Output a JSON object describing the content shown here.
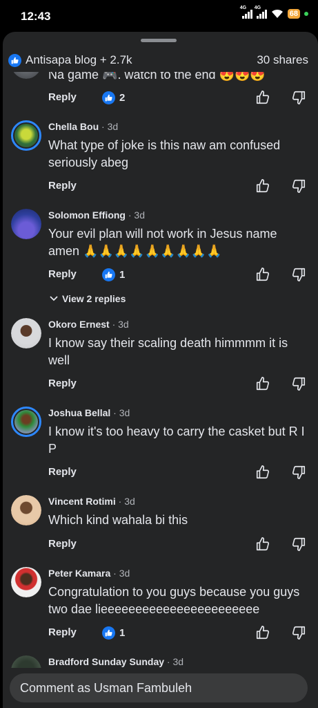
{
  "status": {
    "time": "12:43",
    "network1": "4G",
    "network2": "4G",
    "battery": "68"
  },
  "header": {
    "reactions": "Antisapa blog + 2.7k",
    "shares": "30 shares"
  },
  "comments": [
    {
      "name": "",
      "time": "",
      "text": "Na game 🎮. watch to the end 😍😍😍",
      "reply": "Reply",
      "likes": "2",
      "replies": ""
    },
    {
      "name": "Chella Bou",
      "time": "· 3d",
      "text": "What type of joke is this naw am confused seriously abeg",
      "reply": "Reply",
      "likes": "",
      "replies": ""
    },
    {
      "name": "Solomon Effiong",
      "time": "· 3d",
      "text": "Your evil plan will not work in Jesus name amen 🙏🙏🙏🙏🙏🙏🙏🙏🙏",
      "reply": "Reply",
      "likes": "1",
      "replies": "View 2 replies"
    },
    {
      "name": "Okoro Ernest",
      "time": "· 3d",
      "text": "I know say their scaling death himmmm it is well",
      "reply": "Reply",
      "likes": "",
      "replies": ""
    },
    {
      "name": "Joshua Bellal",
      "time": "· 3d",
      "text": "I know it's too heavy to carry the casket but R I P",
      "reply": "Reply",
      "likes": "",
      "replies": ""
    },
    {
      "name": "Vincent Rotimi",
      "time": "· 3d",
      "text": "Which kind wahala bi this",
      "reply": "Reply",
      "likes": "",
      "replies": ""
    },
    {
      "name": "Peter Kamara",
      "time": "· 3d",
      "text": "Congratulation to you guys because you guys two dae lieeeeeeeeeeeeeeeeeeeeeee",
      "reply": "Reply",
      "likes": "1",
      "replies": ""
    },
    {
      "name": "Bradford Sunday Sunday",
      "time": "· 3d",
      "text": "",
      "reply": "",
      "likes": "",
      "replies": ""
    }
  ],
  "composer": {
    "placeholder": "Comment as Usman Fambuleh"
  },
  "colors": {
    "sheet_bg": "#242526",
    "accent": "#1877f2",
    "text": "#e4e6eb",
    "secondary": "#b0b3b8"
  }
}
